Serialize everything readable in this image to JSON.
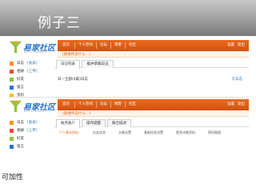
{
  "slide": {
    "title": "例子三",
    "caption": "可加性"
  },
  "colors": {
    "header_top": "#c9c9c9",
    "header_bottom": "#7a7a7a",
    "nav_orange": "#e0631a",
    "link_blue": "#2b74c8"
  },
  "screen1": {
    "logo_text": "易家社区",
    "logo_sub": "EJIA COMMUNITY",
    "nav": [
      "首页",
      "个人空间",
      "论坛",
      "博客",
      "社区"
    ],
    "nav_right": [
      "设置",
      "退出"
    ],
    "tagline": "(随便所说什么…)",
    "sidebar": [
      {
        "label": "日志",
        "link": "[发表]"
      },
      {
        "label": "相册",
        "link": "[上传]"
      },
      {
        "label": "好友",
        "link": ""
      },
      {
        "label": "留言",
        "link": ""
      },
      {
        "label": "资料",
        "link": ""
      }
    ],
    "tabs": [
      "日记列表",
      "缓冲草稿日记"
    ],
    "row_text": "日—全部(4篇)日志",
    "row_link": "写日志"
  },
  "screen2": {
    "logo_text": "易家社区",
    "logo_sub": "EJIA COMMUNITY",
    "nav": [
      "首页",
      "个人空间",
      "论坛",
      "博客",
      "社区"
    ],
    "nav_right": [
      "设置",
      "退出"
    ],
    "tagline": "(随便所说什么…)",
    "sidebar": [
      {
        "label": "日志",
        "link": "[发表]"
      },
      {
        "label": "相册",
        "link": "[上传]"
      },
      {
        "label": "好友",
        "link": ""
      },
      {
        "label": "留言",
        "link": ""
      },
      {
        "label": "资料",
        "link": ""
      }
    ],
    "tabs": [
      "帐务账户",
      "操作提醒",
      "账仓描述"
    ],
    "subtabs": [
      "个人基本资料",
      "交友信息",
      "头像设置",
      "基础信息设置",
      "更多详细资料",
      "密码管理"
    ]
  }
}
